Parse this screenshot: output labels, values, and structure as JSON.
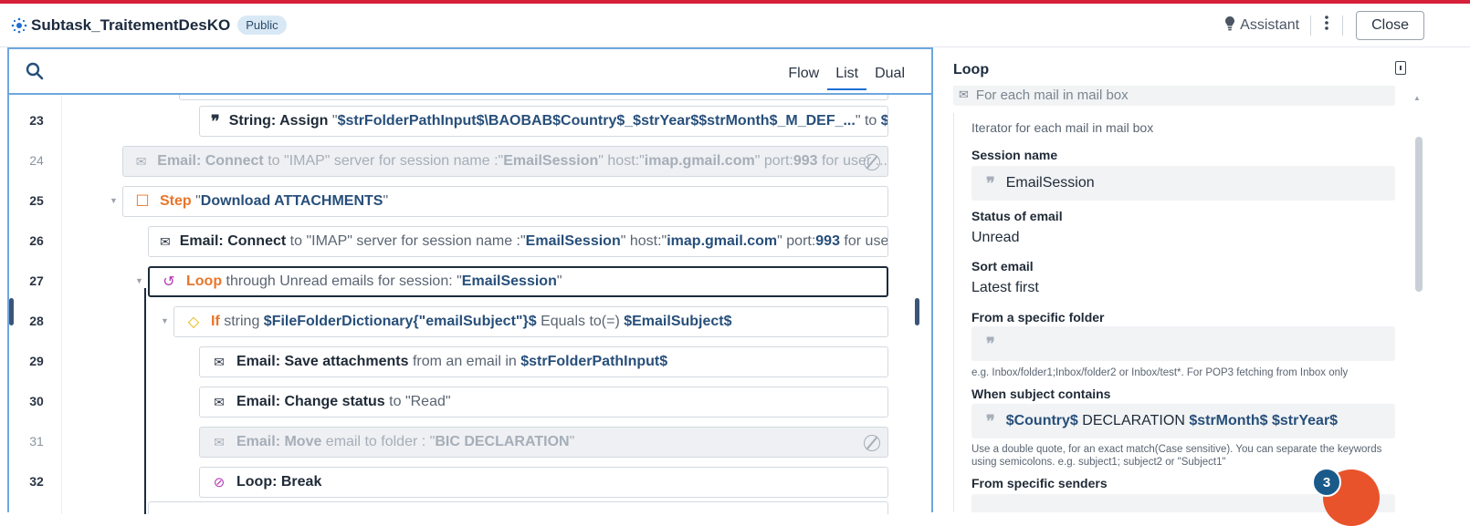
{
  "header": {
    "title": "Subtask_TraitementDesKO",
    "badge": "Public",
    "assistant": "Assistant",
    "close": "Close"
  },
  "toolbar": {
    "tabs": [
      "Flow",
      "List",
      "Dual"
    ],
    "active_tab": "List"
  },
  "rows": {
    "r23": {
      "num": "23",
      "action": "String: Assign",
      "q1": "\"",
      "path": "$strFolderPathInput$\\BAOBAB$Country$_$strYear$$strMonth$_M_DEF_...",
      "q2": "\"",
      "to": " to ",
      "tail": "$s..."
    },
    "r24": {
      "num": "24",
      "action": "Email: Connect",
      "t1": " to \"IMAP\" server for session name :\"",
      "session": "EmailSession",
      "t2": "\" host:\"",
      "host": "imap.gmail.com",
      "t3": "\" port:",
      "port": "993",
      "t4": " for user ..."
    },
    "r25": {
      "num": "25",
      "keyword": "Step",
      "t1": " \"",
      "name": "Download ATTACHMENTS",
      "t2": "\""
    },
    "r26": {
      "num": "26",
      "action": "Email: Connect",
      "t1": " to \"IMAP\" server for session name :\"",
      "session": "EmailSession",
      "t2": "\" host:\"",
      "host": "imap.gmail.com",
      "t3": "\" port:",
      "port": "993",
      "t4": " for user..."
    },
    "r27": {
      "num": "27",
      "keyword": "Loop",
      "t1": " through Unread emails for session: \"",
      "session": "EmailSession",
      "t2": "\""
    },
    "r28": {
      "num": "28",
      "keyword": "If",
      "t1": " string ",
      "var": "$FileFolderDictionary{\"emailSubject\"}$",
      "t2": " Equals to(=) ",
      "var2": "$EmailSubject$"
    },
    "r29": {
      "num": "29",
      "action": "Email: Save attachments",
      "t1": " from an email in ",
      "var": "$strFolderPathInput$"
    },
    "r30": {
      "num": "30",
      "action": "Email: Change status",
      "t1": " to \"Read\""
    },
    "r31": {
      "num": "31",
      "action": "Email: Move",
      "t1": " email to folder : \"",
      "folder": "BIC DECLARATION",
      "t2": "\""
    },
    "r32": {
      "num": "32",
      "action": "Loop: Break"
    }
  },
  "panel": {
    "title": "Loop",
    "partial_item": "For each mail in mail box",
    "description": "Iterator for each mail in mail box",
    "session_label": "Session name",
    "session_value": "EmailSession",
    "status_label": "Status of email",
    "status_value": "Unread",
    "sort_label": "Sort email",
    "sort_value": "Latest first",
    "folder_label": "From a specific folder",
    "folder_value": "",
    "folder_hint": "e.g. Inbox/folder1;Inbox/folder2 or Inbox/test*. For POP3 fetching from Inbox only",
    "subject_label": "When subject contains",
    "subject_v1": "$Country$",
    "subject_t1": " DECLARATION ",
    "subject_v2": "$strMonth$",
    "subject_t2": " ",
    "subject_v3": "$strYear$",
    "subject_hint": "Use a double quote, for an exact match(Case sensitive). You can separate the keywords using semicolons. e.g. subject1; subject2 or \"Subject1\"",
    "senders_label": "From specific senders"
  },
  "notification_count": "3",
  "icons": [
    "logo-icon",
    "bulb-icon",
    "kebab-icon",
    "search-icon",
    "quote-icon",
    "mail-icon",
    "step-icon",
    "loop-icon",
    "if-icon",
    "loop-break-icon",
    "disabled-icon",
    "document-icon"
  ],
  "colors": {
    "accent": "#1b6fd6",
    "brand": "#d6203a",
    "step": "#e8762b",
    "loop": "#b43cb4",
    "if": "#e5b400",
    "variable": "#274f7a"
  }
}
